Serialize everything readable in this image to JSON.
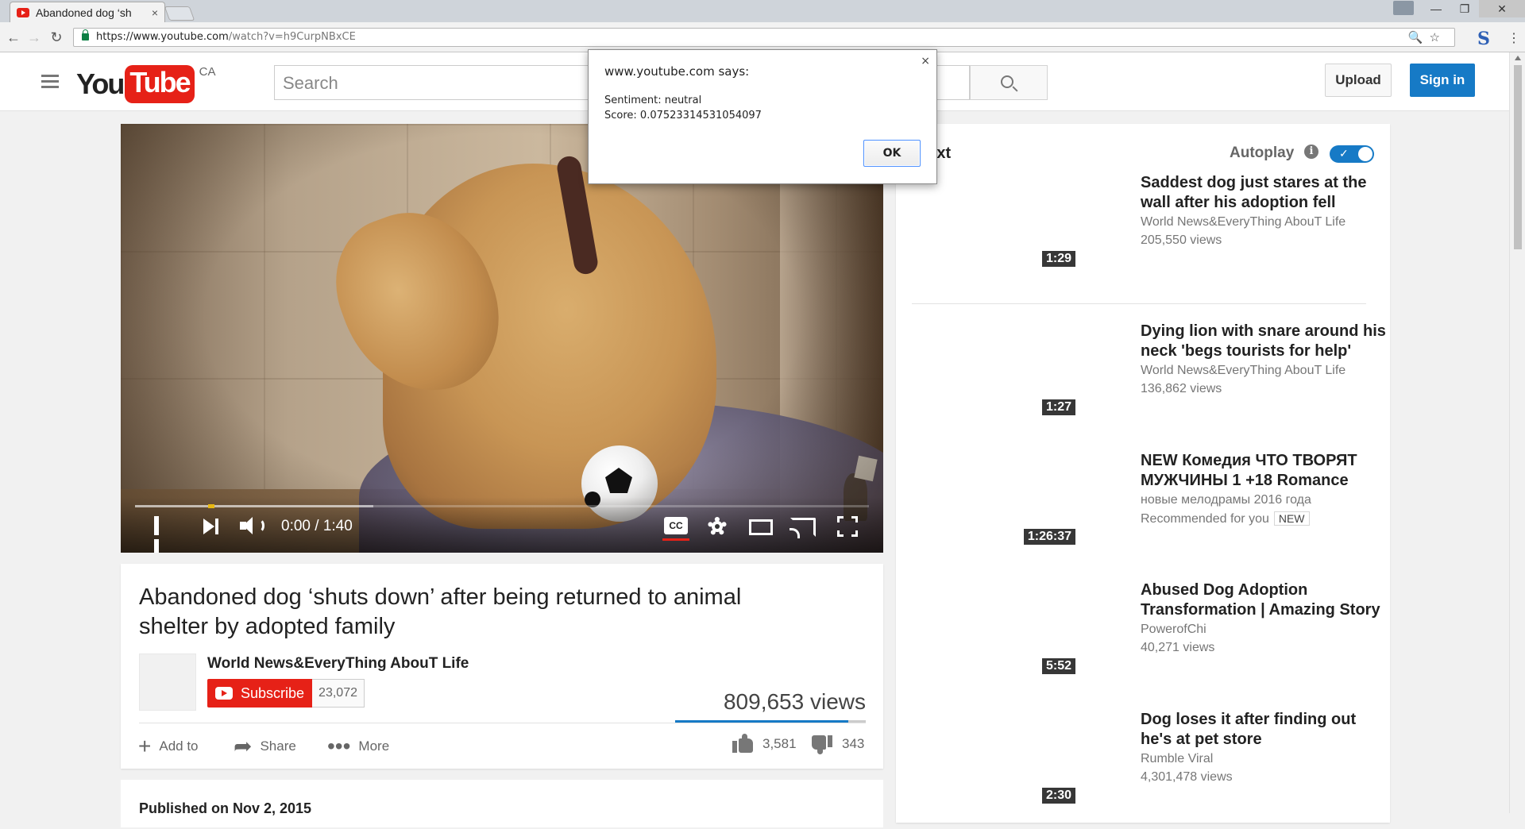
{
  "browser": {
    "tab_title": "Abandoned dog ‘sh",
    "tab_close": "×",
    "url_host": "https://www.youtube.com",
    "url_path": "/watch?v=h9CurpNBxCE",
    "win_minimize": "—",
    "win_restore": "❐",
    "win_close": "✕",
    "ext_label": "S",
    "menu_dots": "⋮",
    "omni_icons": "🔍☆"
  },
  "masthead": {
    "logo_you": "You",
    "logo_tube": "Tube",
    "logo_region": "CA",
    "search_placeholder": "Search",
    "upload_label": "Upload",
    "signin_label": "Sign in"
  },
  "player": {
    "time": "0:00 / 1:40",
    "cc_label": "CC",
    "buffered_fraction": 0.325,
    "played_fraction": 0.0
  },
  "video": {
    "title": "Abandoned dog ‘shuts down’ after being returned to animal shelter by adopted family",
    "channel": "World News&EveryThing AbouT Life",
    "subscribe_label": "Subscribe",
    "subscriber_count": "23,072",
    "views": "809,653 views",
    "like_ratio": 0.91,
    "add_to_label": "Add to",
    "share_label": "Share",
    "more_label": "More",
    "likes": "3,581",
    "dislikes": "343",
    "published": "Published on Nov 2, 2015"
  },
  "sidebar": {
    "up_next": "next",
    "autoplay_label": "Autoplay",
    "autoplay_info": "i",
    "autoplay_on": true,
    "recommendations": [
      {
        "title": "Saddest dog just stares at the wall after his adoption fell",
        "channel": "World News&EveryThing AbouT Life",
        "views": "205,550 views",
        "duration": "1:29"
      },
      {
        "title": "Dying lion with snare around his neck 'begs tourists for help'",
        "channel": "World News&EveryThing AbouT Life",
        "views": "136,862 views",
        "duration": "1:27"
      },
      {
        "title": "NEW Комедия ЧТО ТВОРЯТ МУЖЧИНЫ 1 +18 Romance",
        "channel": "новые мелодрамы 2016 года",
        "views": "Recommended for you",
        "badge": "NEW",
        "duration": "1:26:37"
      },
      {
        "title": "Abused Dog Adoption Transformation | Amazing Story",
        "channel": "PowerofChi",
        "views": "40,271 views",
        "duration": "5:52"
      },
      {
        "title": "Dog loses it after finding out he's at pet store",
        "channel": "Rumble Viral",
        "views": "4,301,478 views",
        "duration": "2:30"
      }
    ]
  },
  "dialog": {
    "title": "www.youtube.com says:",
    "close": "×",
    "line1": "Sentiment: neutral",
    "line2": "Score: 0.07523314531054097",
    "ok_label": "OK"
  }
}
